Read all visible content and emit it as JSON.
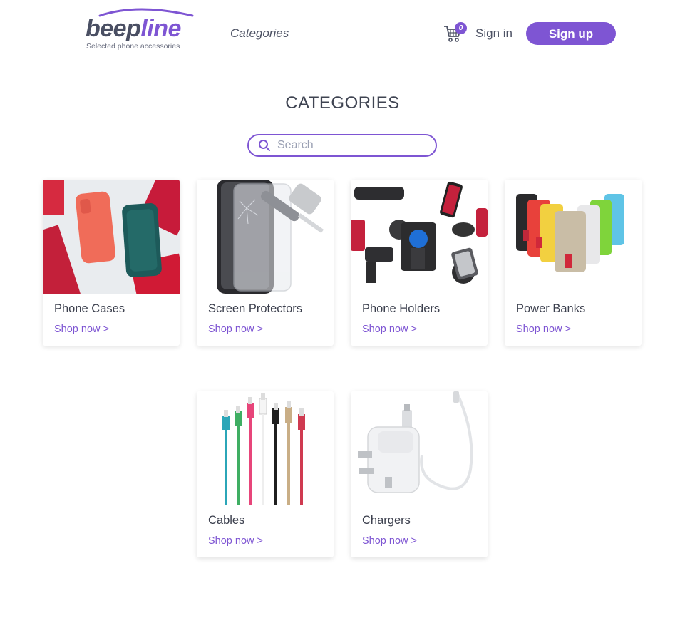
{
  "header": {
    "logo": {
      "beep": "beep",
      "line": "line",
      "tagline": "Selected phone accessories"
    },
    "nav_categories": "Categories",
    "cart": {
      "icon": "cart-icon",
      "count": "0"
    },
    "signin_label": "Sign in",
    "signup_label": "Sign up"
  },
  "page": {
    "title": "CATEGORIES",
    "search": {
      "placeholder": "Search",
      "value": "",
      "icon": "search-icon"
    }
  },
  "categories": [
    {
      "name": "Phone Cases",
      "link": "Shop now >"
    },
    {
      "name": "Screen Protectors",
      "link": "Shop now >"
    },
    {
      "name": "Phone Holders",
      "link": "Shop now >"
    },
    {
      "name": "Power Banks",
      "link": "Shop now >"
    },
    {
      "name": "Cables",
      "link": "Shop now >"
    },
    {
      "name": "Chargers",
      "link": "Shop now >"
    }
  ],
  "colors": {
    "accent": "#7e55d3",
    "text": "#3b3f4d"
  }
}
